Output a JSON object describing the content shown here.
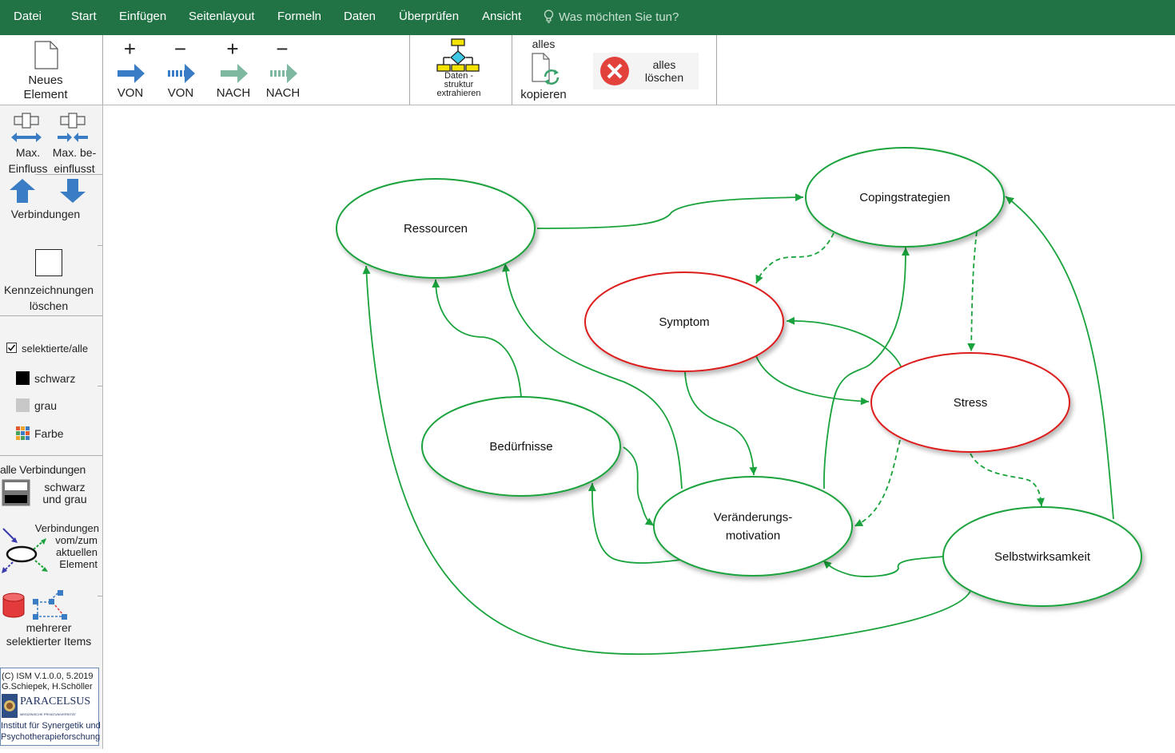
{
  "menu": {
    "items": [
      "Datei",
      "Start",
      "Einfügen",
      "Seitenlayout",
      "Formeln",
      "Daten",
      "Überprüfen",
      "Ansicht"
    ],
    "tell_me": "Was möchten Sie tun?"
  },
  "ribbon": {
    "new_element": [
      "Neues",
      "Element"
    ],
    "arrows": [
      {
        "sign": "+",
        "label": "VON"
      },
      {
        "sign": "−",
        "label": "VON"
      },
      {
        "sign": "+",
        "label": "NACH"
      },
      {
        "sign": "−",
        "label": "NACH"
      }
    ],
    "extract": [
      "Daten -",
      "struktur",
      "extrahieren"
    ],
    "copy_top": "alles",
    "copy_bottom": "kopieren",
    "delete_all": [
      "alles",
      "löschen"
    ]
  },
  "sidebar": {
    "max_influence": [
      "Max.",
      "Einfluss"
    ],
    "max_influenced": [
      "Max. be-",
      "einflusst"
    ],
    "connections": "Verbindungen",
    "clear_marks": [
      "Kennzeichnungen",
      "löschen"
    ],
    "selected_all": "selektierte/alle",
    "selected_all_checked": true,
    "color_options": [
      {
        "label": "schwarz",
        "color": "#000000"
      },
      {
        "label": "grau",
        "color": "#c8c8c8"
      },
      {
        "label": "Farbe",
        "color": "multi"
      }
    ],
    "all_connections": "alle Verbindungen",
    "black_gray": [
      "schwarz",
      "und grau"
    ],
    "from_to_current": [
      "Verbindungen",
      "vom/zum",
      "aktuellen",
      "Element"
    ],
    "multi_select": [
      "mehrerer",
      "selektierter Items"
    ],
    "credits": [
      "(C) ISM V.1.0.0, 5.2019",
      "G.Schiepek, H.Schöller"
    ],
    "logo": [
      "PARACELSUS",
      "MEDIZINISCHE PRIVATUNIVERSITÄT"
    ],
    "institute": [
      "Institut für Synergetik und",
      "Psychotherapieforschung"
    ]
  },
  "diagram": {
    "nodes": [
      {
        "id": "ressourcen",
        "label": [
          "Ressourcen"
        ],
        "border": "#1aa33c"
      },
      {
        "id": "copingstrategien",
        "label": [
          "Copingstrategien"
        ],
        "border": "#1aa33c"
      },
      {
        "id": "symptom",
        "label": [
          "Symptom"
        ],
        "border": "#dd1f1f"
      },
      {
        "id": "stress",
        "label": [
          "Stress"
        ],
        "border": "#dd1f1f"
      },
      {
        "id": "beduerfnisse",
        "label": [
          "Bedürfnisse"
        ],
        "border": "#1aa33c"
      },
      {
        "id": "veraenderungsmotivation",
        "label": [
          "Veränderungs-",
          "motivation"
        ],
        "border": "#1aa33c"
      },
      {
        "id": "selbstwirksamkeit",
        "label": [
          "Selbstwirksamkeit"
        ],
        "border": "#1aa33c"
      }
    ],
    "edges": [
      {
        "from": "ressourcen",
        "to": "copingstrategien",
        "style": "solid"
      },
      {
        "from": "copingstrategien",
        "to": "symptom",
        "style": "dashed"
      },
      {
        "from": "copingstrategien",
        "to": "stress",
        "style": "dashed"
      },
      {
        "from": "beduerfnisse",
        "to": "ressourcen",
        "style": "solid"
      },
      {
        "from": "veraenderungsmotivation",
        "to": "ressourcen",
        "style": "solid"
      },
      {
        "from": "selbstwirksamkeit",
        "to": "ressourcen",
        "style": "solid"
      },
      {
        "from": "selbstwirksamkeit",
        "to": "copingstrategien",
        "style": "solid"
      },
      {
        "from": "stress",
        "to": "symptom",
        "style": "solid"
      },
      {
        "from": "symptom",
        "to": "stress",
        "style": "solid"
      },
      {
        "from": "symptom",
        "to": "veraenderungsmotivation",
        "style": "solid"
      },
      {
        "from": "veraenderungsmotivation",
        "to": "copingstrategien",
        "style": "solid"
      },
      {
        "from": "stress",
        "to": "veraenderungsmotivation",
        "style": "dashed"
      },
      {
        "from": "stress",
        "to": "selbstwirksamkeit",
        "style": "dashed"
      },
      {
        "from": "beduerfnisse",
        "to": "veraenderungsmotivation",
        "style": "solid"
      },
      {
        "from": "veraenderungsmotivation",
        "to": "beduerfnisse",
        "style": "solid"
      },
      {
        "from": "selbstwirksamkeit",
        "to": "veraenderungsmotivation",
        "style": "solid"
      }
    ],
    "edge_color": "#1aa33c"
  }
}
